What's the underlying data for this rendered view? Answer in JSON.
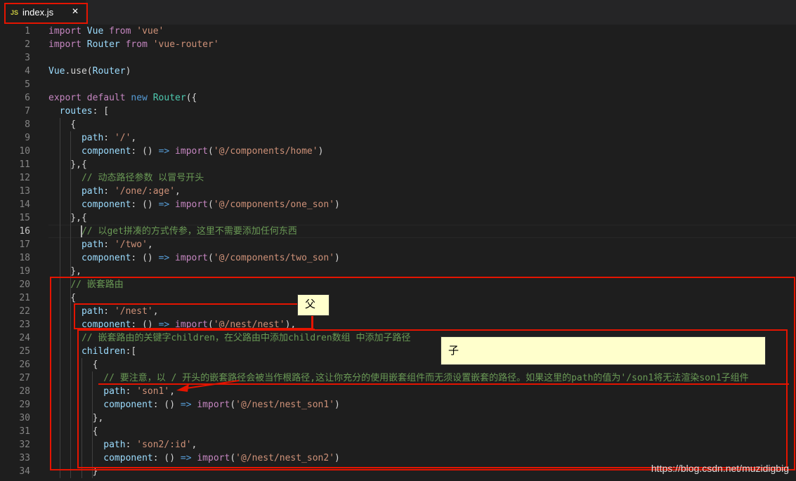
{
  "tab": {
    "icon_text": "JS",
    "filename": "index.js",
    "close": "✕"
  },
  "lines": [
    {
      "n": "1",
      "tokens": [
        [
          "kw",
          "import"
        ],
        [
          "t",
          " "
        ],
        [
          "var",
          "Vue"
        ],
        [
          "t",
          " "
        ],
        [
          "kw",
          "from"
        ],
        [
          "t",
          " "
        ],
        [
          "str",
          "'vue'"
        ]
      ]
    },
    {
      "n": "2",
      "tokens": [
        [
          "kw",
          "import"
        ],
        [
          "t",
          " "
        ],
        [
          "var",
          "Router"
        ],
        [
          "t",
          " "
        ],
        [
          "kw",
          "from"
        ],
        [
          "t",
          " "
        ],
        [
          "str",
          "'vue-router'"
        ]
      ]
    },
    {
      "n": "3",
      "tokens": []
    },
    {
      "n": "4",
      "tokens": [
        [
          "var",
          "Vue"
        ],
        [
          "t",
          "."
        ],
        [
          "t",
          "use"
        ],
        [
          "t",
          "("
        ],
        [
          "var",
          "Router"
        ],
        [
          "t",
          ")"
        ]
      ]
    },
    {
      "n": "5",
      "tokens": []
    },
    {
      "n": "6",
      "tokens": [
        [
          "kw",
          "export"
        ],
        [
          "t",
          " "
        ],
        [
          "kw",
          "default"
        ],
        [
          "t",
          " "
        ],
        [
          "kw2",
          "new"
        ],
        [
          "t",
          " "
        ],
        [
          "cls",
          "Router"
        ],
        [
          "t",
          "({"
        ]
      ]
    },
    {
      "n": "7",
      "tokens": [
        [
          "t",
          "  "
        ],
        [
          "var",
          "routes"
        ],
        [
          "t",
          ": ["
        ]
      ]
    },
    {
      "n": "8",
      "tokens": [
        [
          "t",
          "    {"
        ]
      ]
    },
    {
      "n": "9",
      "tokens": [
        [
          "t",
          "      "
        ],
        [
          "var",
          "path"
        ],
        [
          "t",
          ": "
        ],
        [
          "str",
          "'/'"
        ],
        [
          "t",
          ","
        ]
      ]
    },
    {
      "n": "10",
      "tokens": [
        [
          "t",
          "      "
        ],
        [
          "var",
          "component"
        ],
        [
          "t",
          ": () "
        ],
        [
          "kw2",
          "=>"
        ],
        [
          "t",
          " "
        ],
        [
          "kw",
          "import"
        ],
        [
          "t",
          "("
        ],
        [
          "str",
          "'@/components/home'"
        ],
        [
          "t",
          ")"
        ]
      ]
    },
    {
      "n": "11",
      "tokens": [
        [
          "t",
          "    },{"
        ]
      ]
    },
    {
      "n": "12",
      "tokens": [
        [
          "t",
          "      "
        ],
        [
          "cmt",
          "// 动态路径参数 以冒号开头"
        ]
      ]
    },
    {
      "n": "13",
      "tokens": [
        [
          "t",
          "      "
        ],
        [
          "var",
          "path"
        ],
        [
          "t",
          ": "
        ],
        [
          "str",
          "'/one/:age'"
        ],
        [
          "t",
          ","
        ]
      ]
    },
    {
      "n": "14",
      "tokens": [
        [
          "t",
          "      "
        ],
        [
          "var",
          "component"
        ],
        [
          "t",
          ": () "
        ],
        [
          "kw2",
          "=>"
        ],
        [
          "t",
          " "
        ],
        [
          "kw",
          "import"
        ],
        [
          "t",
          "("
        ],
        [
          "str",
          "'@/components/one_son'"
        ],
        [
          "t",
          ")"
        ]
      ]
    },
    {
      "n": "15",
      "tokens": [
        [
          "t",
          "    },{"
        ]
      ]
    },
    {
      "n": "16",
      "tokens": [
        [
          "t",
          "      "
        ],
        [
          "cmt",
          "// 以get拼凑的方式传参，这里不需要添加任何东西"
        ]
      ]
    },
    {
      "n": "17",
      "tokens": [
        [
          "t",
          "      "
        ],
        [
          "var",
          "path"
        ],
        [
          "t",
          ": "
        ],
        [
          "str",
          "'/two'"
        ],
        [
          "t",
          ","
        ]
      ]
    },
    {
      "n": "18",
      "tokens": [
        [
          "t",
          "      "
        ],
        [
          "var",
          "component"
        ],
        [
          "t",
          ": () "
        ],
        [
          "kw2",
          "=>"
        ],
        [
          "t",
          " "
        ],
        [
          "kw",
          "import"
        ],
        [
          "t",
          "("
        ],
        [
          "str",
          "'@/components/two_son'"
        ],
        [
          "t",
          ")"
        ]
      ]
    },
    {
      "n": "19",
      "tokens": [
        [
          "t",
          "    },"
        ]
      ]
    },
    {
      "n": "20",
      "tokens": [
        [
          "t",
          "    "
        ],
        [
          "cmt",
          "// 嵌套路由"
        ]
      ]
    },
    {
      "n": "21",
      "tokens": [
        [
          "t",
          "    {"
        ]
      ]
    },
    {
      "n": "22",
      "tokens": [
        [
          "t",
          "      "
        ],
        [
          "var",
          "path"
        ],
        [
          "t",
          ": "
        ],
        [
          "str",
          "'/nest'"
        ],
        [
          "t",
          ","
        ]
      ]
    },
    {
      "n": "23",
      "tokens": [
        [
          "t",
          "      "
        ],
        [
          "var",
          "component"
        ],
        [
          "t",
          ": () "
        ],
        [
          "kw2",
          "=>"
        ],
        [
          "t",
          " "
        ],
        [
          "kw",
          "import"
        ],
        [
          "t",
          "("
        ],
        [
          "str",
          "'@/nest/nest'"
        ],
        [
          "t",
          "),"
        ]
      ]
    },
    {
      "n": "24",
      "tokens": [
        [
          "t",
          "      "
        ],
        [
          "cmt",
          "// 嵌套路由的关键字children，在父路由中添加children数组 中添加子路径"
        ]
      ]
    },
    {
      "n": "25",
      "tokens": [
        [
          "t",
          "      "
        ],
        [
          "var",
          "children"
        ],
        [
          "t",
          ":["
        ]
      ]
    },
    {
      "n": "26",
      "tokens": [
        [
          "t",
          "        {"
        ]
      ]
    },
    {
      "n": "27",
      "tokens": [
        [
          "t",
          "          "
        ],
        [
          "cmt",
          "// 要注意，以 / 开头的嵌套路径会被当作根路径,这让你充分的使用嵌套组件而无须设置嵌套的路径。如果这里的path的值为'/son1将无法渲染son1子组件"
        ]
      ]
    },
    {
      "n": "28",
      "tokens": [
        [
          "t",
          "          "
        ],
        [
          "var",
          "path"
        ],
        [
          "t",
          ": "
        ],
        [
          "str",
          "'son1'"
        ],
        [
          "t",
          ","
        ]
      ]
    },
    {
      "n": "29",
      "tokens": [
        [
          "t",
          "          "
        ],
        [
          "var",
          "component"
        ],
        [
          "t",
          ": () "
        ],
        [
          "kw2",
          "=>"
        ],
        [
          "t",
          " "
        ],
        [
          "kw",
          "import"
        ],
        [
          "t",
          "("
        ],
        [
          "str",
          "'@/nest/nest_son1'"
        ],
        [
          "t",
          ")"
        ]
      ]
    },
    {
      "n": "30",
      "tokens": [
        [
          "t",
          "        },"
        ]
      ]
    },
    {
      "n": "31",
      "tokens": [
        [
          "t",
          "        {"
        ]
      ]
    },
    {
      "n": "32",
      "tokens": [
        [
          "t",
          "          "
        ],
        [
          "var",
          "path"
        ],
        [
          "t",
          ": "
        ],
        [
          "str",
          "'son2/:id'"
        ],
        [
          "t",
          ","
        ]
      ]
    },
    {
      "n": "33",
      "tokens": [
        [
          "t",
          "          "
        ],
        [
          "var",
          "component"
        ],
        [
          "t",
          ": () "
        ],
        [
          "kw2",
          "=>"
        ],
        [
          "t",
          " "
        ],
        [
          "kw",
          "import"
        ],
        [
          "t",
          "("
        ],
        [
          "str",
          "'@/nest/nest_son2'"
        ],
        [
          "t",
          ")"
        ]
      ]
    },
    {
      "n": "34",
      "tokens": [
        [
          "t",
          "        }"
        ]
      ]
    }
  ],
  "active_line": "16",
  "annotations": {
    "parent_label": "父",
    "child_label": "子"
  },
  "watermark": "https://blog.csdn.net/muzidigbig",
  "colors": {
    "highlight_box": "#e51400",
    "note_bg": "#ffffcc"
  }
}
